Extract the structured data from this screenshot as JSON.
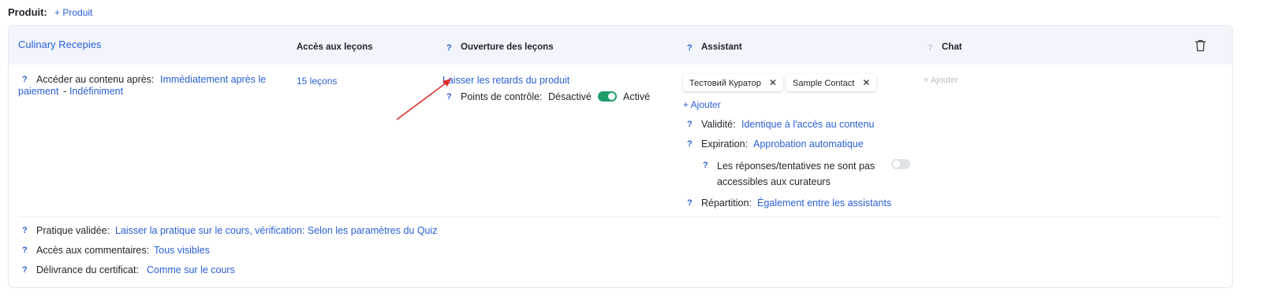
{
  "product": {
    "label": "Produit:",
    "add": "+ Produit"
  },
  "course": {
    "title": "Culinary Recepies"
  },
  "headers": {
    "access": "Accès aux leçons",
    "opening": "Ouverture des leçons",
    "assistant": "Assistant",
    "chat": "Chat"
  },
  "help_icon": "?",
  "access_content": {
    "label": "Accéder au contenu après:",
    "value_line1": "Immédiatement après le",
    "value_line2": "paiement",
    "separator": "-",
    "duration": "Indéfiniment"
  },
  "lessons": {
    "count": "15 leçons"
  },
  "opening": {
    "value": "Laisser les retards du produit",
    "checkpoints_label": "Points de contrôle:",
    "off_label": "Désactivé",
    "on_label": "Activé",
    "checkpoints_enabled": true
  },
  "assistants": {
    "tags": [
      "Тестовий Куратор",
      "Sample Contact"
    ],
    "add": "+ Ajouter",
    "validity_label": "Validité:",
    "validity_value": "Identique à l'accès au contenu",
    "expiration_label": "Expiration:",
    "expiration_value": "Approbation automatique",
    "answers_line1": "Les réponses/tentatives ne sont pas",
    "answers_line2": "accessibles aux curateurs",
    "answers_enabled": false,
    "distribution_label": "Répartition:",
    "distribution_value": "Également entre les assistants"
  },
  "chat": {
    "add": "+ Ajouter"
  },
  "bottom": {
    "practice_label": "Pratique validée:",
    "practice_value": "Laisser la pratique sur le cours, vérification: Selon les paramètres du Quiz",
    "comments_label": "Accès aux commentaires:",
    "comments_value": "Tous visibles",
    "certificate_label": "Délivrance du certificat:",
    "certificate_value": "Comme sur le cours"
  },
  "colors": {
    "link": "#2a5fd6",
    "toggle_on": "#1f9d6b",
    "toggle_off": "#dfe3e8",
    "header_bg": "#f2f6fc",
    "annotation_arrow": "#e0302a"
  },
  "icons": [
    "help-icon",
    "trash-icon",
    "close-icon",
    "annotation-arrow"
  ]
}
